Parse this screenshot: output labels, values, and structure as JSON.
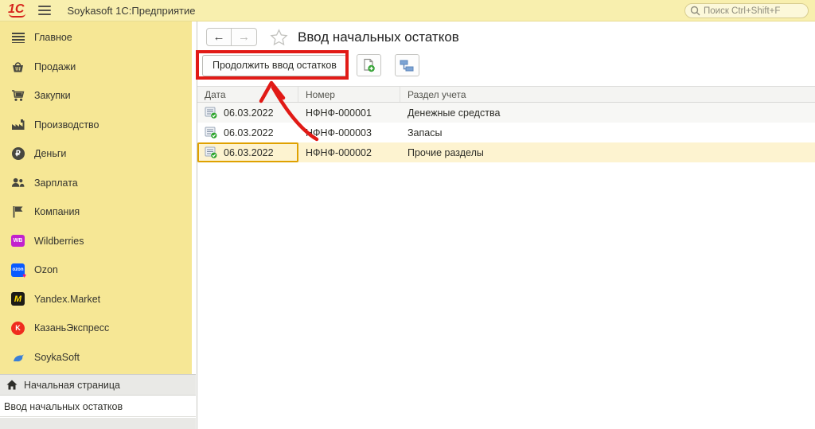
{
  "app": {
    "logo_text": "1С",
    "title": "Soykasoft 1С:Предприятие",
    "search_placeholder": "Поиск Ctrl+Shift+F"
  },
  "sidebar": {
    "items": [
      {
        "label": "Главное"
      },
      {
        "label": "Продажи"
      },
      {
        "label": "Закупки"
      },
      {
        "label": "Производство"
      },
      {
        "label": "Деньги"
      },
      {
        "label": "Зарплата"
      },
      {
        "label": "Компания"
      },
      {
        "label": "Wildberries"
      },
      {
        "label": "Ozon"
      },
      {
        "label": "Yandex.Market"
      },
      {
        "label": "КазаньЭкспресс"
      },
      {
        "label": "SoykaSoft"
      }
    ]
  },
  "badges": {
    "wildberries": "WB",
    "ozon": "ozon",
    "yandex_market": "M",
    "kazanexpress": "K"
  },
  "taskbar": {
    "home": "Начальная страница",
    "open_window": "Ввод начальных остатков"
  },
  "content": {
    "title": "Ввод начальных остатков",
    "toolbar": {
      "continue_button": "Продолжить ввод остатков"
    },
    "table": {
      "columns": [
        "Дата",
        "Номер",
        "Раздел учета"
      ],
      "rows": [
        {
          "date": "06.03.2022",
          "number": "НФНФ-000001",
          "section": "Денежные средства"
        },
        {
          "date": "06.03.2022",
          "number": "НФНФ-000003",
          "section": "Запасы"
        },
        {
          "date": "06.03.2022",
          "number": "НФНФ-000002",
          "section": "Прочие разделы",
          "selected": "true"
        }
      ]
    }
  },
  "colors": {
    "annotation_red": "#e11a16",
    "topbar_bg": "#f8efae",
    "sidebar_bg": "#f6e795",
    "selected_row_bg": "#fdf3d0",
    "focused_cell_border": "#dfa100",
    "logo_red": "#d6231c"
  }
}
